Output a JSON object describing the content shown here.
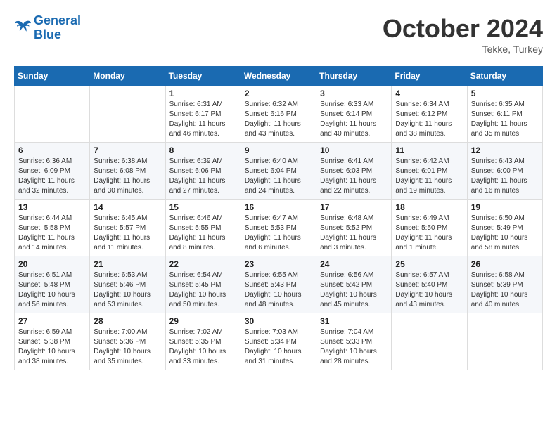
{
  "header": {
    "logo_line1": "General",
    "logo_line2": "Blue",
    "month_title": "October 2024",
    "location": "Tekke, Turkey"
  },
  "weekdays": [
    "Sunday",
    "Monday",
    "Tuesday",
    "Wednesday",
    "Thursday",
    "Friday",
    "Saturday"
  ],
  "weeks": [
    [
      {
        "day": "",
        "info": ""
      },
      {
        "day": "",
        "info": ""
      },
      {
        "day": "1",
        "info": "Sunrise: 6:31 AM\nSunset: 6:17 PM\nDaylight: 11 hours and 46 minutes."
      },
      {
        "day": "2",
        "info": "Sunrise: 6:32 AM\nSunset: 6:16 PM\nDaylight: 11 hours and 43 minutes."
      },
      {
        "day": "3",
        "info": "Sunrise: 6:33 AM\nSunset: 6:14 PM\nDaylight: 11 hours and 40 minutes."
      },
      {
        "day": "4",
        "info": "Sunrise: 6:34 AM\nSunset: 6:12 PM\nDaylight: 11 hours and 38 minutes."
      },
      {
        "day": "5",
        "info": "Sunrise: 6:35 AM\nSunset: 6:11 PM\nDaylight: 11 hours and 35 minutes."
      }
    ],
    [
      {
        "day": "6",
        "info": "Sunrise: 6:36 AM\nSunset: 6:09 PM\nDaylight: 11 hours and 32 minutes."
      },
      {
        "day": "7",
        "info": "Sunrise: 6:38 AM\nSunset: 6:08 PM\nDaylight: 11 hours and 30 minutes."
      },
      {
        "day": "8",
        "info": "Sunrise: 6:39 AM\nSunset: 6:06 PM\nDaylight: 11 hours and 27 minutes."
      },
      {
        "day": "9",
        "info": "Sunrise: 6:40 AM\nSunset: 6:04 PM\nDaylight: 11 hours and 24 minutes."
      },
      {
        "day": "10",
        "info": "Sunrise: 6:41 AM\nSunset: 6:03 PM\nDaylight: 11 hours and 22 minutes."
      },
      {
        "day": "11",
        "info": "Sunrise: 6:42 AM\nSunset: 6:01 PM\nDaylight: 11 hours and 19 minutes."
      },
      {
        "day": "12",
        "info": "Sunrise: 6:43 AM\nSunset: 6:00 PM\nDaylight: 11 hours and 16 minutes."
      }
    ],
    [
      {
        "day": "13",
        "info": "Sunrise: 6:44 AM\nSunset: 5:58 PM\nDaylight: 11 hours and 14 minutes."
      },
      {
        "day": "14",
        "info": "Sunrise: 6:45 AM\nSunset: 5:57 PM\nDaylight: 11 hours and 11 minutes."
      },
      {
        "day": "15",
        "info": "Sunrise: 6:46 AM\nSunset: 5:55 PM\nDaylight: 11 hours and 8 minutes."
      },
      {
        "day": "16",
        "info": "Sunrise: 6:47 AM\nSunset: 5:53 PM\nDaylight: 11 hours and 6 minutes."
      },
      {
        "day": "17",
        "info": "Sunrise: 6:48 AM\nSunset: 5:52 PM\nDaylight: 11 hours and 3 minutes."
      },
      {
        "day": "18",
        "info": "Sunrise: 6:49 AM\nSunset: 5:50 PM\nDaylight: 11 hours and 1 minute."
      },
      {
        "day": "19",
        "info": "Sunrise: 6:50 AM\nSunset: 5:49 PM\nDaylight: 10 hours and 58 minutes."
      }
    ],
    [
      {
        "day": "20",
        "info": "Sunrise: 6:51 AM\nSunset: 5:48 PM\nDaylight: 10 hours and 56 minutes."
      },
      {
        "day": "21",
        "info": "Sunrise: 6:53 AM\nSunset: 5:46 PM\nDaylight: 10 hours and 53 minutes."
      },
      {
        "day": "22",
        "info": "Sunrise: 6:54 AM\nSunset: 5:45 PM\nDaylight: 10 hours and 50 minutes."
      },
      {
        "day": "23",
        "info": "Sunrise: 6:55 AM\nSunset: 5:43 PM\nDaylight: 10 hours and 48 minutes."
      },
      {
        "day": "24",
        "info": "Sunrise: 6:56 AM\nSunset: 5:42 PM\nDaylight: 10 hours and 45 minutes."
      },
      {
        "day": "25",
        "info": "Sunrise: 6:57 AM\nSunset: 5:40 PM\nDaylight: 10 hours and 43 minutes."
      },
      {
        "day": "26",
        "info": "Sunrise: 6:58 AM\nSunset: 5:39 PM\nDaylight: 10 hours and 40 minutes."
      }
    ],
    [
      {
        "day": "27",
        "info": "Sunrise: 6:59 AM\nSunset: 5:38 PM\nDaylight: 10 hours and 38 minutes."
      },
      {
        "day": "28",
        "info": "Sunrise: 7:00 AM\nSunset: 5:36 PM\nDaylight: 10 hours and 35 minutes."
      },
      {
        "day": "29",
        "info": "Sunrise: 7:02 AM\nSunset: 5:35 PM\nDaylight: 10 hours and 33 minutes."
      },
      {
        "day": "30",
        "info": "Sunrise: 7:03 AM\nSunset: 5:34 PM\nDaylight: 10 hours and 31 minutes."
      },
      {
        "day": "31",
        "info": "Sunrise: 7:04 AM\nSunset: 5:33 PM\nDaylight: 10 hours and 28 minutes."
      },
      {
        "day": "",
        "info": ""
      },
      {
        "day": "",
        "info": ""
      }
    ]
  ]
}
